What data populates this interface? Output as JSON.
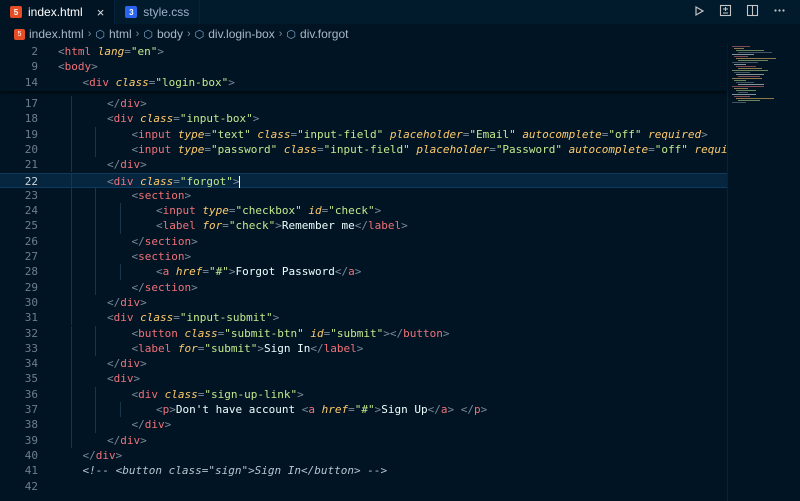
{
  "tabs": [
    {
      "label": "index.html",
      "icon": "html5-icon",
      "active": true
    },
    {
      "label": "style.css",
      "icon": "css3-icon",
      "active": false
    }
  ],
  "tab_close_symbol": "×",
  "breadcrumb": [
    "index.html",
    "html",
    "body",
    "div.login-box",
    "div.forgot"
  ],
  "editor": {
    "sticky_lines": [
      {
        "num": "2",
        "indent": 0,
        "code": [
          [
            "t",
            "<"
          ],
          [
            "tag",
            "html"
          ],
          [
            "t",
            " "
          ],
          [
            "attr",
            "lang"
          ],
          [
            "t",
            "="
          ],
          [
            "str",
            "\"en\""
          ],
          [
            "t",
            ">"
          ]
        ]
      },
      {
        "num": "9",
        "indent": 0,
        "code": [
          [
            "t",
            "<"
          ],
          [
            "tag",
            "body"
          ],
          [
            "t",
            ">"
          ]
        ]
      },
      {
        "num": "14",
        "indent": 1,
        "code": [
          [
            "t",
            "<"
          ],
          [
            "tag",
            "div"
          ],
          [
            "t",
            " "
          ],
          [
            "attr",
            "class"
          ],
          [
            "t",
            "="
          ],
          [
            "str",
            "\"login-box\""
          ],
          [
            "t",
            ">"
          ]
        ]
      }
    ],
    "lines": [
      {
        "num": "17",
        "indent": 2,
        "code": [
          [
            "t",
            "</"
          ],
          [
            "tag",
            "div"
          ],
          [
            "t",
            ">"
          ]
        ]
      },
      {
        "num": "18",
        "indent": 2,
        "code": [
          [
            "t",
            "<"
          ],
          [
            "tag",
            "div"
          ],
          [
            "t",
            " "
          ],
          [
            "attr",
            "class"
          ],
          [
            "t",
            "="
          ],
          [
            "str",
            "\"input-box\""
          ],
          [
            "t",
            ">"
          ]
        ]
      },
      {
        "num": "19",
        "indent": 3,
        "code": [
          [
            "t",
            "<"
          ],
          [
            "tag",
            "input"
          ],
          [
            "t",
            " "
          ],
          [
            "attr",
            "type"
          ],
          [
            "t",
            "="
          ],
          [
            "str",
            "\"text\""
          ],
          [
            "t",
            " "
          ],
          [
            "attr",
            "class"
          ],
          [
            "t",
            "="
          ],
          [
            "str",
            "\"input-field\""
          ],
          [
            "t",
            " "
          ],
          [
            "attr",
            "placeholder"
          ],
          [
            "t",
            "="
          ],
          [
            "str",
            "\"Email\""
          ],
          [
            "t",
            " "
          ],
          [
            "attr",
            "autocomplete"
          ],
          [
            "t",
            "="
          ],
          [
            "str",
            "\"off\""
          ],
          [
            "t",
            " "
          ],
          [
            "attr",
            "required"
          ],
          [
            "t",
            ">"
          ]
        ]
      },
      {
        "num": "20",
        "indent": 3,
        "code": [
          [
            "t",
            "<"
          ],
          [
            "tag",
            "input"
          ],
          [
            "t",
            " "
          ],
          [
            "attr",
            "type"
          ],
          [
            "t",
            "="
          ],
          [
            "str",
            "\"password\""
          ],
          [
            "t",
            " "
          ],
          [
            "attr",
            "class"
          ],
          [
            "t",
            "="
          ],
          [
            "str",
            "\"input-field\""
          ],
          [
            "t",
            " "
          ],
          [
            "attr",
            "placeholder"
          ],
          [
            "t",
            "="
          ],
          [
            "str",
            "\"Password\""
          ],
          [
            "t",
            " "
          ],
          [
            "attr",
            "autocomplete"
          ],
          [
            "t",
            "="
          ],
          [
            "str",
            "\"off\""
          ],
          [
            "t",
            " "
          ],
          [
            "attr",
            "required"
          ],
          [
            "t",
            ">"
          ]
        ]
      },
      {
        "num": "21",
        "indent": 2,
        "code": [
          [
            "t",
            "</"
          ],
          [
            "tag",
            "div"
          ],
          [
            "t",
            ">"
          ]
        ]
      },
      {
        "num": "22",
        "indent": 2,
        "current": true,
        "code": [
          [
            "t",
            "<"
          ],
          [
            "tag",
            "div"
          ],
          [
            "t",
            " "
          ],
          [
            "attr",
            "class"
          ],
          [
            "t",
            "="
          ],
          [
            "str",
            "\"forgot\""
          ],
          [
            "t",
            ">"
          ]
        ]
      },
      {
        "num": "23",
        "indent": 3,
        "code": [
          [
            "t",
            "<"
          ],
          [
            "tag",
            "section"
          ],
          [
            "t",
            ">"
          ]
        ]
      },
      {
        "num": "24",
        "indent": 4,
        "code": [
          [
            "t",
            "<"
          ],
          [
            "tag",
            "input"
          ],
          [
            "t",
            " "
          ],
          [
            "attr",
            "type"
          ],
          [
            "t",
            "="
          ],
          [
            "str",
            "\"checkbox\""
          ],
          [
            "t",
            " "
          ],
          [
            "attr",
            "id"
          ],
          [
            "t",
            "="
          ],
          [
            "str",
            "\"check\""
          ],
          [
            "t",
            ">"
          ]
        ]
      },
      {
        "num": "25",
        "indent": 4,
        "code": [
          [
            "t",
            "<"
          ],
          [
            "tag",
            "label"
          ],
          [
            "t",
            " "
          ],
          [
            "attr",
            "for"
          ],
          [
            "t",
            "="
          ],
          [
            "str",
            "\"check\""
          ],
          [
            "t",
            ">"
          ],
          [
            "txt",
            "Remember me"
          ],
          [
            "t",
            "</"
          ],
          [
            "tag",
            "label"
          ],
          [
            "t",
            ">"
          ]
        ]
      },
      {
        "num": "26",
        "indent": 3,
        "code": [
          [
            "t",
            "</"
          ],
          [
            "tag",
            "section"
          ],
          [
            "t",
            ">"
          ]
        ]
      },
      {
        "num": "27",
        "indent": 3,
        "code": [
          [
            "t",
            "<"
          ],
          [
            "tag",
            "section"
          ],
          [
            "t",
            ">"
          ]
        ]
      },
      {
        "num": "28",
        "indent": 4,
        "code": [
          [
            "t",
            "<"
          ],
          [
            "tag",
            "a"
          ],
          [
            "t",
            " "
          ],
          [
            "attr",
            "href"
          ],
          [
            "t",
            "="
          ],
          [
            "str",
            "\"#\""
          ],
          [
            "t",
            ">"
          ],
          [
            "txt",
            "Forgot Password"
          ],
          [
            "t",
            "</"
          ],
          [
            "tag",
            "a"
          ],
          [
            "t",
            ">"
          ]
        ]
      },
      {
        "num": "29",
        "indent": 3,
        "code": [
          [
            "t",
            "</"
          ],
          [
            "tag",
            "section"
          ],
          [
            "t",
            ">"
          ]
        ]
      },
      {
        "num": "30",
        "indent": 2,
        "code": [
          [
            "t",
            "</"
          ],
          [
            "tag",
            "div"
          ],
          [
            "t",
            ">"
          ]
        ]
      },
      {
        "num": "31",
        "indent": 2,
        "code": [
          [
            "t",
            "<"
          ],
          [
            "tag",
            "div"
          ],
          [
            "t",
            " "
          ],
          [
            "attr",
            "class"
          ],
          [
            "t",
            "="
          ],
          [
            "str",
            "\"input-submit\""
          ],
          [
            "t",
            ">"
          ]
        ]
      },
      {
        "num": "32",
        "indent": 3,
        "code": [
          [
            "t",
            "<"
          ],
          [
            "tag",
            "button"
          ],
          [
            "t",
            " "
          ],
          [
            "attr",
            "class"
          ],
          [
            "t",
            "="
          ],
          [
            "str",
            "\"submit-btn\""
          ],
          [
            "t",
            " "
          ],
          [
            "attr",
            "id"
          ],
          [
            "t",
            "="
          ],
          [
            "str",
            "\"submit\""
          ],
          [
            "t",
            "></"
          ],
          [
            "tag",
            "button"
          ],
          [
            "t",
            ">"
          ]
        ]
      },
      {
        "num": "33",
        "indent": 3,
        "code": [
          [
            "t",
            "<"
          ],
          [
            "tag",
            "label"
          ],
          [
            "t",
            " "
          ],
          [
            "attr",
            "for"
          ],
          [
            "t",
            "="
          ],
          [
            "str",
            "\"submit\""
          ],
          [
            "t",
            ">"
          ],
          [
            "txt",
            "Sign In"
          ],
          [
            "t",
            "</"
          ],
          [
            "tag",
            "label"
          ],
          [
            "t",
            ">"
          ]
        ]
      },
      {
        "num": "34",
        "indent": 2,
        "code": [
          [
            "t",
            "</"
          ],
          [
            "tag",
            "div"
          ],
          [
            "t",
            ">"
          ]
        ]
      },
      {
        "num": "35",
        "indent": 2,
        "code": [
          [
            "t",
            "<"
          ],
          [
            "tag",
            "div"
          ],
          [
            "t",
            ">"
          ]
        ]
      },
      {
        "num": "36",
        "indent": 3,
        "code": [
          [
            "t",
            "<"
          ],
          [
            "tag",
            "div"
          ],
          [
            "t",
            " "
          ],
          [
            "attr",
            "class"
          ],
          [
            "t",
            "="
          ],
          [
            "str",
            "\"sign-up-link\""
          ],
          [
            "t",
            ">"
          ]
        ]
      },
      {
        "num": "37",
        "indent": 4,
        "code": [
          [
            "t",
            "<"
          ],
          [
            "tag",
            "p"
          ],
          [
            "t",
            ">"
          ],
          [
            "txt",
            "Don't have account "
          ],
          [
            "t",
            "<"
          ],
          [
            "tag",
            "a"
          ],
          [
            "t",
            " "
          ],
          [
            "attr",
            "href"
          ],
          [
            "t",
            "="
          ],
          [
            "str",
            "\"#\""
          ],
          [
            "t",
            ">"
          ],
          [
            "txt",
            "Sign Up"
          ],
          [
            "t",
            "</"
          ],
          [
            "tag",
            "a"
          ],
          [
            "t",
            ">"
          ],
          [
            "txt",
            " "
          ],
          [
            "t",
            "</"
          ],
          [
            "tag",
            "p"
          ],
          [
            "t",
            ">"
          ]
        ]
      },
      {
        "num": "38",
        "indent": 3,
        "code": [
          [
            "t",
            "</"
          ],
          [
            "tag",
            "div"
          ],
          [
            "t",
            ">"
          ]
        ]
      },
      {
        "num": "39",
        "indent": 2,
        "code": [
          [
            "t",
            "</"
          ],
          [
            "tag",
            "div"
          ],
          [
            "t",
            ">"
          ]
        ]
      },
      {
        "num": "40",
        "indent": 1,
        "code": [
          [
            "t",
            "</"
          ],
          [
            "tag",
            "div"
          ],
          [
            "t",
            ">"
          ]
        ]
      },
      {
        "num": "41",
        "indent": 1,
        "code": [
          [
            "cmt",
            "<!-- <button class=\"sign\">Sign In</button> -->"
          ]
        ]
      },
      {
        "num": "42",
        "indent": 0,
        "code": []
      }
    ]
  },
  "colors": {
    "background": "#011423",
    "tag": "#f07178",
    "attribute": "#ffcb6b",
    "string": "#c3e88d",
    "current_line": "#06253f"
  }
}
